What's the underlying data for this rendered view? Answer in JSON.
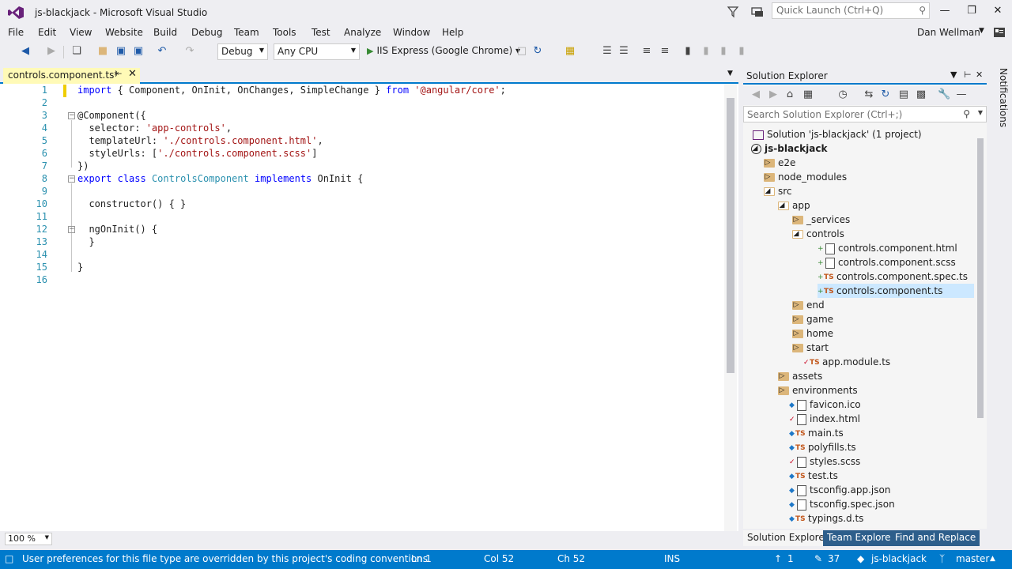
{
  "window": {
    "title": "js-blackjack - Microsoft Visual Studio"
  },
  "quick_launch": {
    "placeholder": "Quick Launch (Ctrl+Q)"
  },
  "menu": [
    "File",
    "Edit",
    "View",
    "Website",
    "Build",
    "Debug",
    "Team",
    "Tools",
    "Test",
    "Analyze",
    "Window",
    "Help"
  ],
  "user": {
    "name": "Dan Wellman"
  },
  "toolbar": {
    "config": "Debug",
    "platform": "Any CPU",
    "run_target": "IIS Express (Google Chrome)"
  },
  "editor": {
    "tab_title": "controls.component.ts*",
    "line_numbers": [
      "1",
      "2",
      "3",
      "4",
      "5",
      "6",
      "7",
      "8",
      "9",
      "10",
      "11",
      "12",
      "13",
      "14",
      "15",
      "16"
    ],
    "zoom": "100 %"
  },
  "solution_explorer": {
    "title": "Solution Explorer",
    "search_placeholder": "Search Solution Explorer (Ctrl+;)",
    "tree": [
      "Solution 'js-blackjack' (1 project)",
      "js-blackjack",
      "e2e",
      "node_modules",
      "src",
      "app",
      "_services",
      "controls",
      "controls.component.html",
      "controls.component.scss",
      "controls.component.spec.ts",
      "controls.component.ts",
      "end",
      "game",
      "home",
      "start",
      "app.module.ts",
      "assets",
      "environments",
      "favicon.ico",
      "index.html",
      "main.ts",
      "polyfills.ts",
      "styles.scss",
      "test.ts",
      "tsconfig.app.json",
      "tsconfig.spec.json",
      "typings.d.ts"
    ],
    "bottom_tabs": [
      "Solution Explorer",
      "Team Explorer",
      "Find and Replace"
    ]
  },
  "notifications": {
    "label": "Notifications"
  },
  "status": {
    "message": "User preferences for this file type are overridden by this project's coding conventions",
    "ln": "Ln 1",
    "col": "Col 52",
    "ch": "Ch 52",
    "mode": "INS",
    "pending": "1",
    "changes": "37",
    "repo": "js-blackjack",
    "branch": "master"
  }
}
